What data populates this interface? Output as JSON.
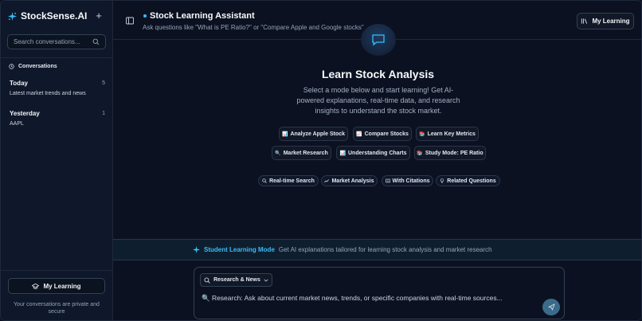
{
  "sidebar": {
    "brand": "StockSense.AI",
    "new_chat_symbol": "+",
    "search_placeholder": "Search conversations...",
    "conversations_label": "Conversations",
    "groups": [
      {
        "title": "Today",
        "count": "5",
        "item": "Latest market trends and news"
      },
      {
        "title": "Yesterday",
        "count": "1",
        "item": "AAPL"
      }
    ],
    "my_learning": "My Learning",
    "privacy_note": "Your conversations are private and secure"
  },
  "header": {
    "title": "Stock Learning Assistant",
    "subtitle": "Ask questions like \"What is PE Ratio?\" or \"Compare Apple and Google stocks\"",
    "my_learning": "My Learning"
  },
  "hero": {
    "title": "Learn Stock Analysis",
    "description": "Select a mode below and start learning! Get AI-powered explanations, real-time data, and research insights to understand the stock market."
  },
  "quick_actions": [
    {
      "emoji": "📊",
      "label": "Analyze Apple Stock"
    },
    {
      "emoji": "📈",
      "label": "Compare Stocks"
    },
    {
      "emoji": "📚",
      "label": "Learn Key Metrics"
    },
    {
      "emoji": "🔍",
      "label": "Market Research"
    },
    {
      "emoji": "📊",
      "label": "Understanding Charts"
    },
    {
      "emoji": "📚",
      "label": "Study Mode: PE Ratio"
    }
  ],
  "features": [
    {
      "icon": "search-icon",
      "label": "Real-time Search"
    },
    {
      "icon": "trend-icon",
      "label": "Market Analysis"
    },
    {
      "icon": "book-icon",
      "label": "With Citations"
    },
    {
      "icon": "lightbulb-icon",
      "label": "Related Questions"
    }
  ],
  "banner": {
    "label": "Student Learning Mode",
    "text": "Get AI explanations tailored for learning stock analysis and market research"
  },
  "composer": {
    "mode": "Research & News",
    "placeholder": "🔍 Research: Ask about current market news, trends, or specific companies with real-time sources..."
  },
  "colors": {
    "accent": "#38bdf8",
    "background": "#0b1120",
    "sidebar": "#0f172a",
    "send_button": "#3b6b8a"
  }
}
